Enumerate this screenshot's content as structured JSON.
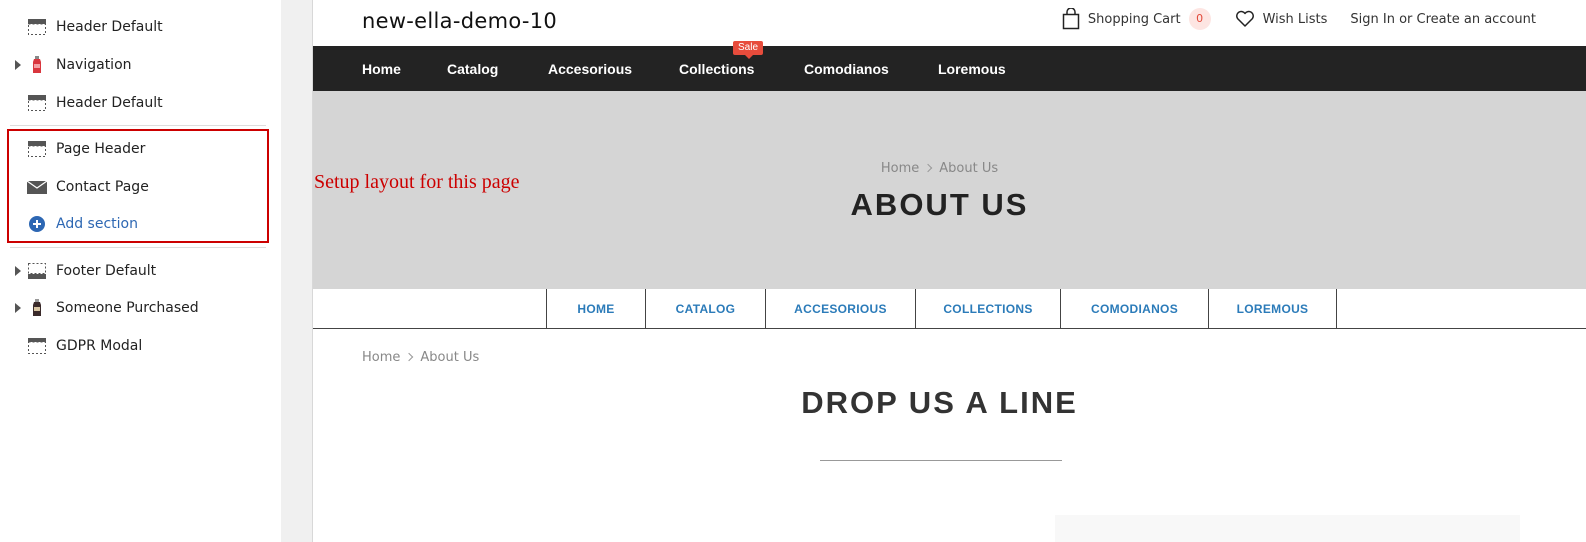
{
  "sidebar": {
    "items": [
      {
        "label": "Header Default",
        "icon": "header-layout-icon"
      },
      {
        "label": "Navigation",
        "icon": "bottle-icon"
      },
      {
        "label": "Header Default",
        "icon": "header-layout-icon"
      },
      {
        "label": "Page Header",
        "icon": "header-layout-icon"
      },
      {
        "label": "Contact Page",
        "icon": "envelope-icon"
      },
      {
        "label": "Add section",
        "icon": "plus-circle-icon"
      },
      {
        "label": "Footer Default",
        "icon": "footer-layout-icon"
      },
      {
        "label": "Someone Purchased",
        "icon": "bottle-icon"
      },
      {
        "label": "GDPR Modal",
        "icon": "modal-layout-icon"
      }
    ]
  },
  "annotation": {
    "text": "Setup layout for this page",
    "color": "#cc0000"
  },
  "preview": {
    "site_title": "new-ella-demo-10",
    "top_links": {
      "cart_label": "Shopping Cart",
      "cart_count": "0",
      "wishlist_label": "Wish Lists",
      "account_label": "Sign In or Create an account"
    },
    "nav": {
      "items": [
        "Home",
        "Catalog",
        "Accesorious",
        "Collections",
        "Comodianos",
        "Loremous"
      ],
      "sale_badge": "Sale"
    },
    "hero": {
      "breadcrumb_home": "Home",
      "breadcrumb_current": "About Us",
      "title": "ABOUT US"
    },
    "tabs": [
      "HOME",
      "CATALOG",
      "ACCESORIOUS",
      "COLLECTIONS",
      "COMODIANOS",
      "LOREMOUS"
    ],
    "content": {
      "breadcrumb_home": "Home",
      "breadcrumb_current": "About Us",
      "title": "DROP US A LINE"
    },
    "colors": {
      "nav_bg": "#232323",
      "hero_bg": "#d5d5d5",
      "tab_text": "#2b7bb9",
      "sale": "#e74c3c"
    }
  }
}
